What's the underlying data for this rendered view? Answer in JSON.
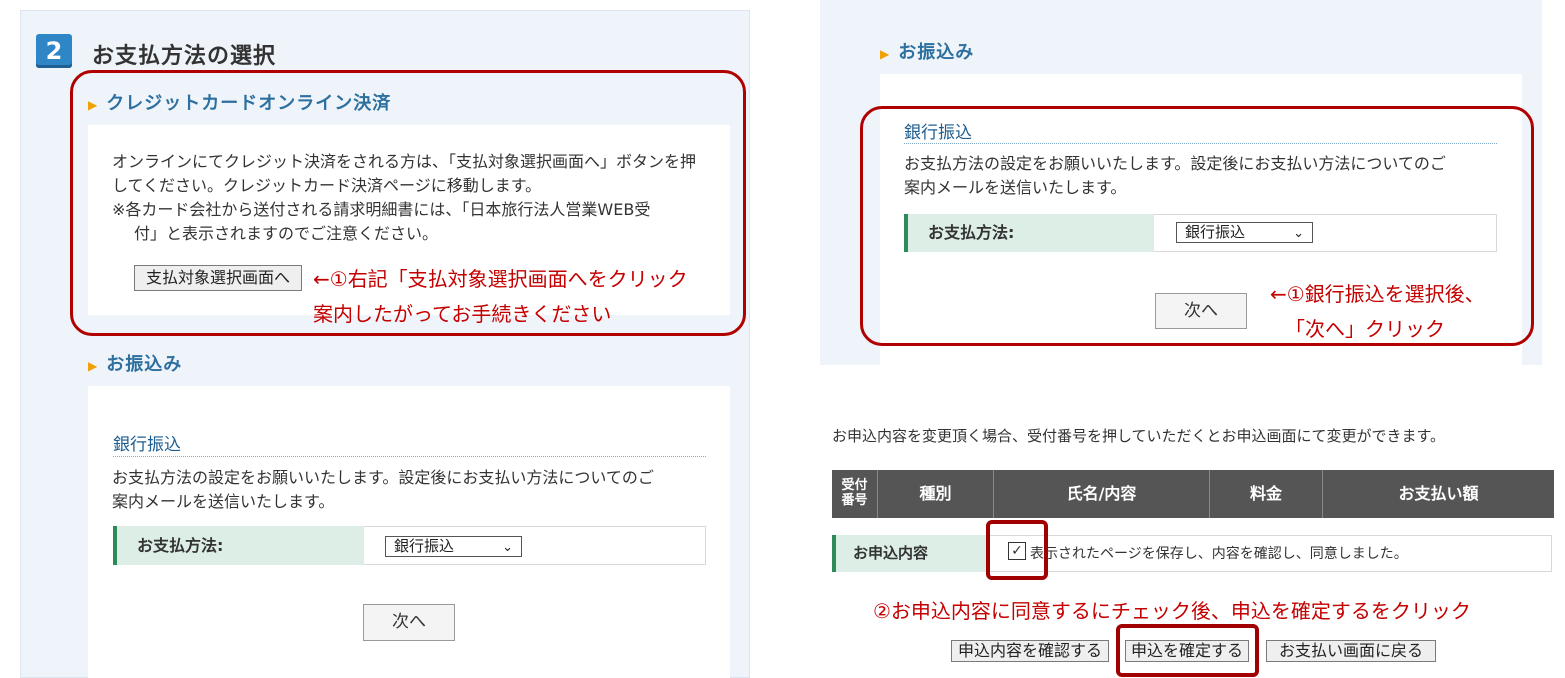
{
  "left": {
    "step_number": "2",
    "step_title": "お支払方法の選択",
    "credit": {
      "heading": "クレジットカードオンライン決済",
      "line1": "オンラインにてクレジット決済をされる方は、「支払対象選択画面へ」ボタンを押",
      "line2": "してください。クレジットカード決済ページに移動します。",
      "line3": "※各カード会社から送付される請求明細書には、「日本旅行法人営業WEB受",
      "line4": "付」と表示されますのでご注意ください。",
      "button": "支払対象選択画面へ",
      "annotation1": "←①右記「支払対象選択画面へをクリック",
      "annotation2": "案内したがってお手続きください"
    },
    "transfer": {
      "heading": "お振込み",
      "bank_title": "銀行振込",
      "desc1": "お支払方法の設定をお願いいたします。設定後にお支払い方法についてのご",
      "desc2": "案内メールを送信いたします。",
      "method_label": "お支払方法:",
      "method_value": "銀行振込",
      "next_button": "次へ"
    }
  },
  "right": {
    "transfer": {
      "heading": "お振込み",
      "bank_title": "銀行振込",
      "desc1": "お支払方法の設定をお願いいたします。設定後にお支払い方法についてのご",
      "desc2": "案内メールを送信いたします。",
      "method_label": "お支払方法:",
      "method_value": "銀行振込",
      "next_button": "次へ",
      "annotation1": "←①銀行振込を選択後、",
      "annotation2": "「次へ」クリック"
    },
    "notice": "お申込内容を変更頂く場合、受付番号を押していただくとお申込画面にて変更ができます。",
    "table": {
      "headers": [
        "受付\n番号",
        "種別",
        "氏名/内容",
        "料金",
        "お支払い額"
      ],
      "header_1a": "受付",
      "header_1b": "番号",
      "row_label": "お申込内容",
      "agree_text": "表示されたページを保存し、内容を確認し、同意しました。",
      "agree_checked": true
    },
    "annotation3": "②お申込内容に同意するにチェック後、申込を確定するをクリック",
    "buttons": {
      "confirm": "申込内容を確認する",
      "submit": "申込を確定する",
      "back": "お支払い画面に戻る"
    }
  },
  "icons": {
    "section_arrow": "triangle-right-icon",
    "select_arrow": "chevron-down-icon",
    "check": "checkmark-icon"
  },
  "colors": {
    "accent_blue": "#2f86c7",
    "heading_blue": "#2d6f9f",
    "annotation_red": "#c40000",
    "frame_red": "#b00000",
    "section_arrow": "#f0a000"
  }
}
